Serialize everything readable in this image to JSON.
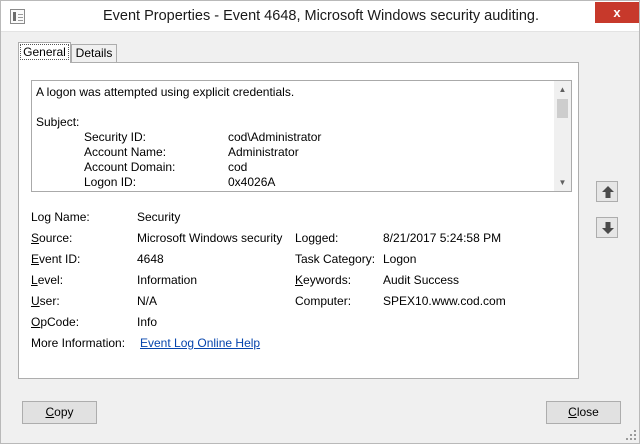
{
  "window": {
    "title": "Event Properties - Event 4648, Microsoft Windows security auditing.",
    "close_glyph": "x"
  },
  "tabs": [
    {
      "label": "General",
      "active": true
    },
    {
      "label": "Details",
      "active": false
    }
  ],
  "description": {
    "summary": "A logon was attempted using explicit credentials.",
    "section": "Subject:",
    "rows": [
      {
        "label": "Security ID:",
        "value": "cod\\Administrator"
      },
      {
        "label": "Account Name:",
        "value": "Administrator"
      },
      {
        "label": "Account Domain:",
        "value": "cod"
      },
      {
        "label": "Logon ID:",
        "value": "0x4026A"
      }
    ]
  },
  "fields": {
    "log_name": {
      "label": "Log Name:",
      "value": "Security"
    },
    "source": {
      "label": "Source:",
      "value": "Microsoft Windows security"
    },
    "logged": {
      "label": "Logged:",
      "value": "8/21/2017 5:24:58 PM"
    },
    "event_id": {
      "label": "Event ID:",
      "value": "4648"
    },
    "task_category": {
      "label": "Task Category:",
      "value": "Logon"
    },
    "level": {
      "label": "Level:",
      "value": "Information"
    },
    "keywords": {
      "label": "Keywords:",
      "value": "Audit Success"
    },
    "user": {
      "label": "User:",
      "value": "N/A"
    },
    "computer": {
      "label": "Computer:",
      "value": "SPEX10.www.cod.com"
    },
    "opcode": {
      "label": "OpCode:",
      "value": "Info"
    },
    "more_info": {
      "label": "More Information:",
      "link": "Event Log Online Help"
    }
  },
  "buttons": {
    "copy": "Copy",
    "close": "Close"
  },
  "icons": {
    "up": "up-arrow-icon",
    "down": "down-arrow-icon"
  }
}
